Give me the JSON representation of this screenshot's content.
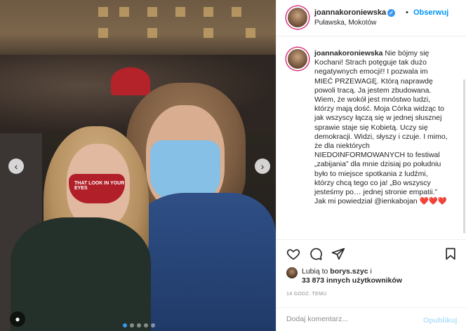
{
  "header": {
    "username": "joannakoroniewska",
    "follow_label": "Obserwuj",
    "separator": "•",
    "location": "Puławska, Mokotów"
  },
  "photo": {
    "mask_text": "THAT LOOK IN YOUR EYES",
    "slide_count": 5,
    "active_slide": 1
  },
  "caption": {
    "username": "joannakoroniewska",
    "text": "Nie bójmy się Kochani! Strach potęguje tak dużo negatywnych emocji!! I pozwala im MIEĆ PRZEWAGĘ. Którą naprawdę powoli tracą. Ja jestem zbudowana. Wiem, że wokół jest mnóstwo ludzi, którzy mają dość. Moja Córka widząc to jak wszyscy łączą się w jednej słusznej sprawie staje się Kobietą. Uczy się demokracji. Widzi, słyszy i czuje. I mimo, że dla niektórych NIEDOINFORMOWANYCH to festiwal „zabijania” dla mnie dzisiaj po południu było to miejsce spotkania z ludźmi, którzy chcą tego co ja! „Bo wszyscy jesteśmy po… jednej stronie empatii.” Jak mi powiedział @ienkabojan ❤️❤️❤️"
  },
  "likes": {
    "line1_prefix": "Lubią to ",
    "line1_user": "borys.szyc",
    "line1_suffix": " i",
    "line2": "33 873 innych użytkowników"
  },
  "timestamp": "14 GODZ. TEMU",
  "comment": {
    "placeholder": "Dodaj komentarz...",
    "post_label": "Opublikuj"
  },
  "colors": {
    "accent": "#0095f6",
    "post_disabled": "#b2dffc",
    "verified": "#3897f0"
  }
}
